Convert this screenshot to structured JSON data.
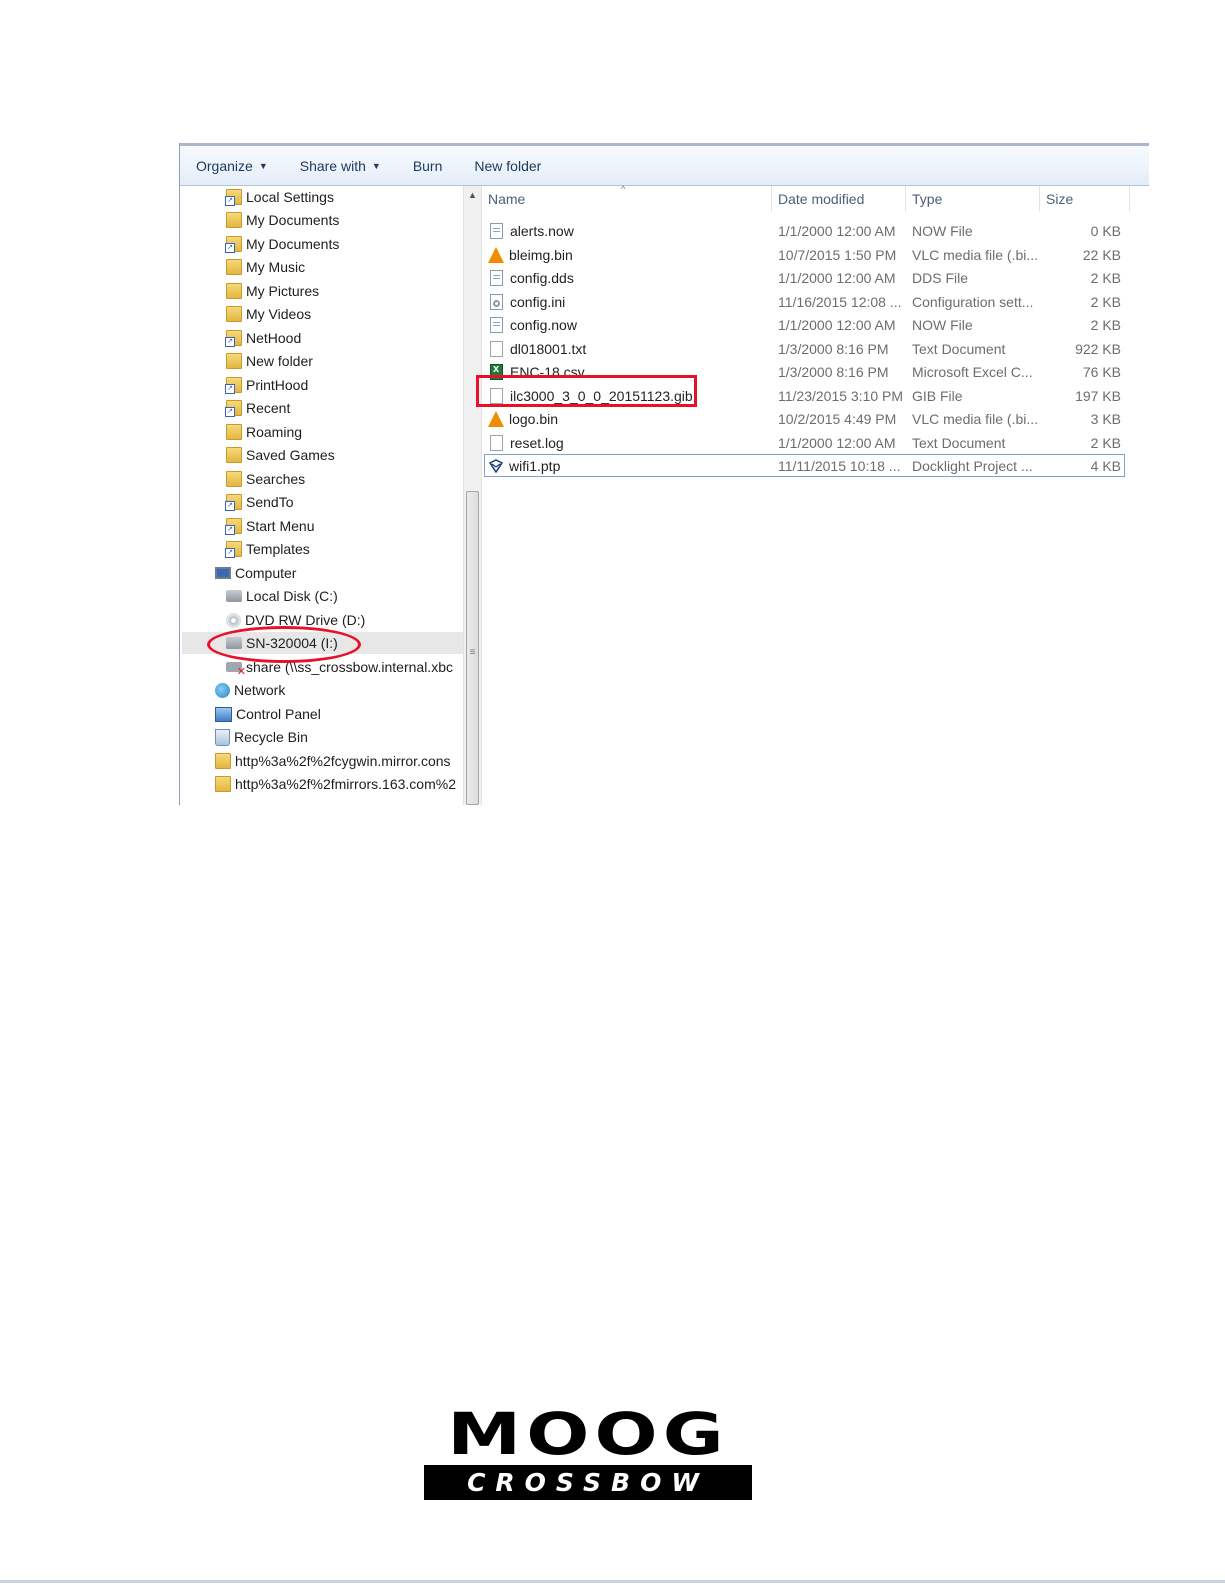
{
  "toolbar": {
    "organize": "Organize",
    "share_with": "Share with",
    "burn": "Burn",
    "new_folder": "New folder"
  },
  "nav": {
    "items": [
      {
        "label": "Local Settings",
        "icon": "folder-shortcut-icon"
      },
      {
        "label": "My Documents",
        "icon": "documents-folder-icon"
      },
      {
        "label": "My Documents",
        "icon": "folder-shortcut-icon"
      },
      {
        "label": "My Music",
        "icon": "music-folder-icon"
      },
      {
        "label": "My Pictures",
        "icon": "pictures-folder-icon"
      },
      {
        "label": "My Videos",
        "icon": "videos-folder-icon"
      },
      {
        "label": "NetHood",
        "icon": "folder-shortcut-icon"
      },
      {
        "label": "New folder",
        "icon": "folder-icon"
      },
      {
        "label": "PrintHood",
        "icon": "folder-shortcut-icon"
      },
      {
        "label": "Recent",
        "icon": "recent-folder-icon"
      },
      {
        "label": "Roaming",
        "icon": "folder-icon"
      },
      {
        "label": "Saved Games",
        "icon": "saved-games-folder-icon"
      },
      {
        "label": "Searches",
        "icon": "searches-folder-icon"
      },
      {
        "label": "SendTo",
        "icon": "folder-shortcut-icon"
      },
      {
        "label": "Start Menu",
        "icon": "folder-shortcut-icon"
      },
      {
        "label": "Templates",
        "icon": "folder-shortcut-icon"
      },
      {
        "label": "Computer",
        "icon": "computer-icon"
      },
      {
        "label": "Local Disk (C:)",
        "icon": "local-disk-icon"
      },
      {
        "label": "DVD RW Drive (D:)",
        "icon": "dvd-drive-icon"
      },
      {
        "label": "SN-320004 (I:)",
        "icon": "removable-drive-icon"
      },
      {
        "label": "share (\\\\ss_crossbow.internal.xbc",
        "icon": "disconnected-network-drive-icon"
      },
      {
        "label": "Network",
        "icon": "network-icon"
      },
      {
        "label": "Control Panel",
        "icon": "control-panel-icon"
      },
      {
        "label": "Recycle Bin",
        "icon": "recycle-bin-icon"
      },
      {
        "label": "http%3a%2f%2fcygwin.mirror.cons",
        "icon": "folder-icon"
      },
      {
        "label": "http%3a%2f%2fmirrors.163.com%2",
        "icon": "folder-icon"
      }
    ]
  },
  "columns": {
    "name": "Name",
    "date_modified": "Date modified",
    "type": "Type",
    "size": "Size"
  },
  "files": [
    {
      "name": "alerts.now",
      "date": "1/1/2000 12:00 AM",
      "type": "NOW File",
      "size": "0 KB",
      "icon": "document-icon"
    },
    {
      "name": "bleimg.bin",
      "date": "10/7/2015 1:50 PM",
      "type": "VLC media file (.bi...",
      "size": "22 KB",
      "icon": "vlc-icon"
    },
    {
      "name": "config.dds",
      "date": "1/1/2000 12:00 AM",
      "type": "DDS File",
      "size": "2 KB",
      "icon": "document-icon"
    },
    {
      "name": "config.ini",
      "date": "11/16/2015 12:08 ...",
      "type": "Configuration sett...",
      "size": "2 KB",
      "icon": "settings-file-icon"
    },
    {
      "name": "config.now",
      "date": "1/1/2000 12:00 AM",
      "type": "NOW File",
      "size": "2 KB",
      "icon": "document-icon"
    },
    {
      "name": "dl018001.txt",
      "date": "1/3/2000 8:16 PM",
      "type": "Text Document",
      "size": "922 KB",
      "icon": "text-file-icon"
    },
    {
      "name": "ENC-18.csv",
      "date": "1/3/2000 8:16 PM",
      "type": "Microsoft Excel C...",
      "size": "76 KB",
      "icon": "excel-icon"
    },
    {
      "name": "ilc3000_3_0_0_20151123.gib",
      "date": "11/23/2015 3:10 PM",
      "type": "GIB File",
      "size": "197 KB",
      "icon": "blank-file-icon"
    },
    {
      "name": "logo.bin",
      "date": "10/2/2015 4:49 PM",
      "type": "VLC media file (.bi...",
      "size": "3 KB",
      "icon": "vlc-icon"
    },
    {
      "name": "reset.log",
      "date": "1/1/2000 12:00 AM",
      "type": "Text Document",
      "size": "2 KB",
      "icon": "text-file-icon"
    },
    {
      "name": "wifi1.ptp",
      "date": "11/11/2015 10:18 ...",
      "type": "Docklight Project ...",
      "size": "4 KB",
      "icon": "docklight-project-icon"
    }
  ],
  "highlight_color": "#e8102b",
  "logo": {
    "wordmark": "MOOG",
    "subbrand": "CROSSBOW"
  }
}
